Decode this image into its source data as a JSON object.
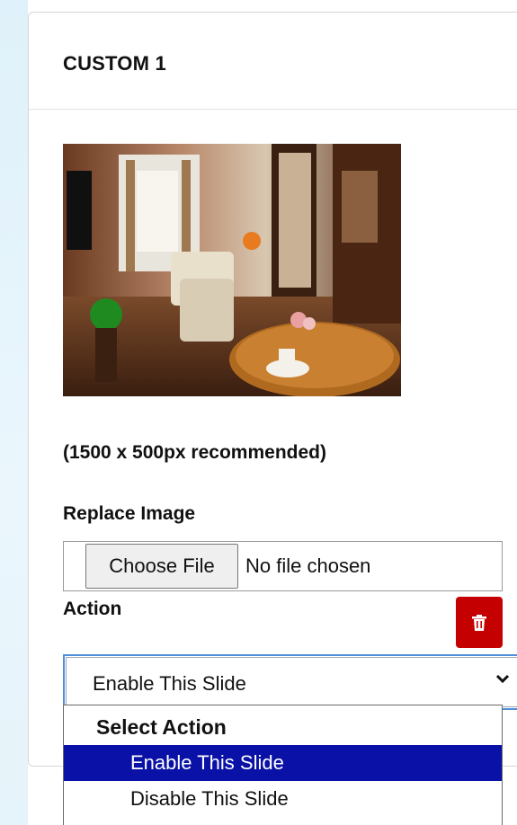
{
  "card": {
    "title": "CUSTOM 1",
    "note": "(1500 x 500px recommended)",
    "replace_label": "Replace Image",
    "file_input": {
      "button_label": "Choose File",
      "status": "No file chosen"
    },
    "action_label": "Action",
    "delete_icon": "trash-icon",
    "select": {
      "value": "Enable This Slide",
      "options": [
        {
          "label": "Select Action",
          "kind": "group"
        },
        {
          "label": "Enable This Slide",
          "kind": "selected"
        },
        {
          "label": "Disable This Slide",
          "kind": "option"
        }
      ]
    }
  },
  "colors": {
    "delete_red": "#c40000",
    "selected_option": "#0a11a6",
    "focus_ring": "#4f8fda"
  }
}
